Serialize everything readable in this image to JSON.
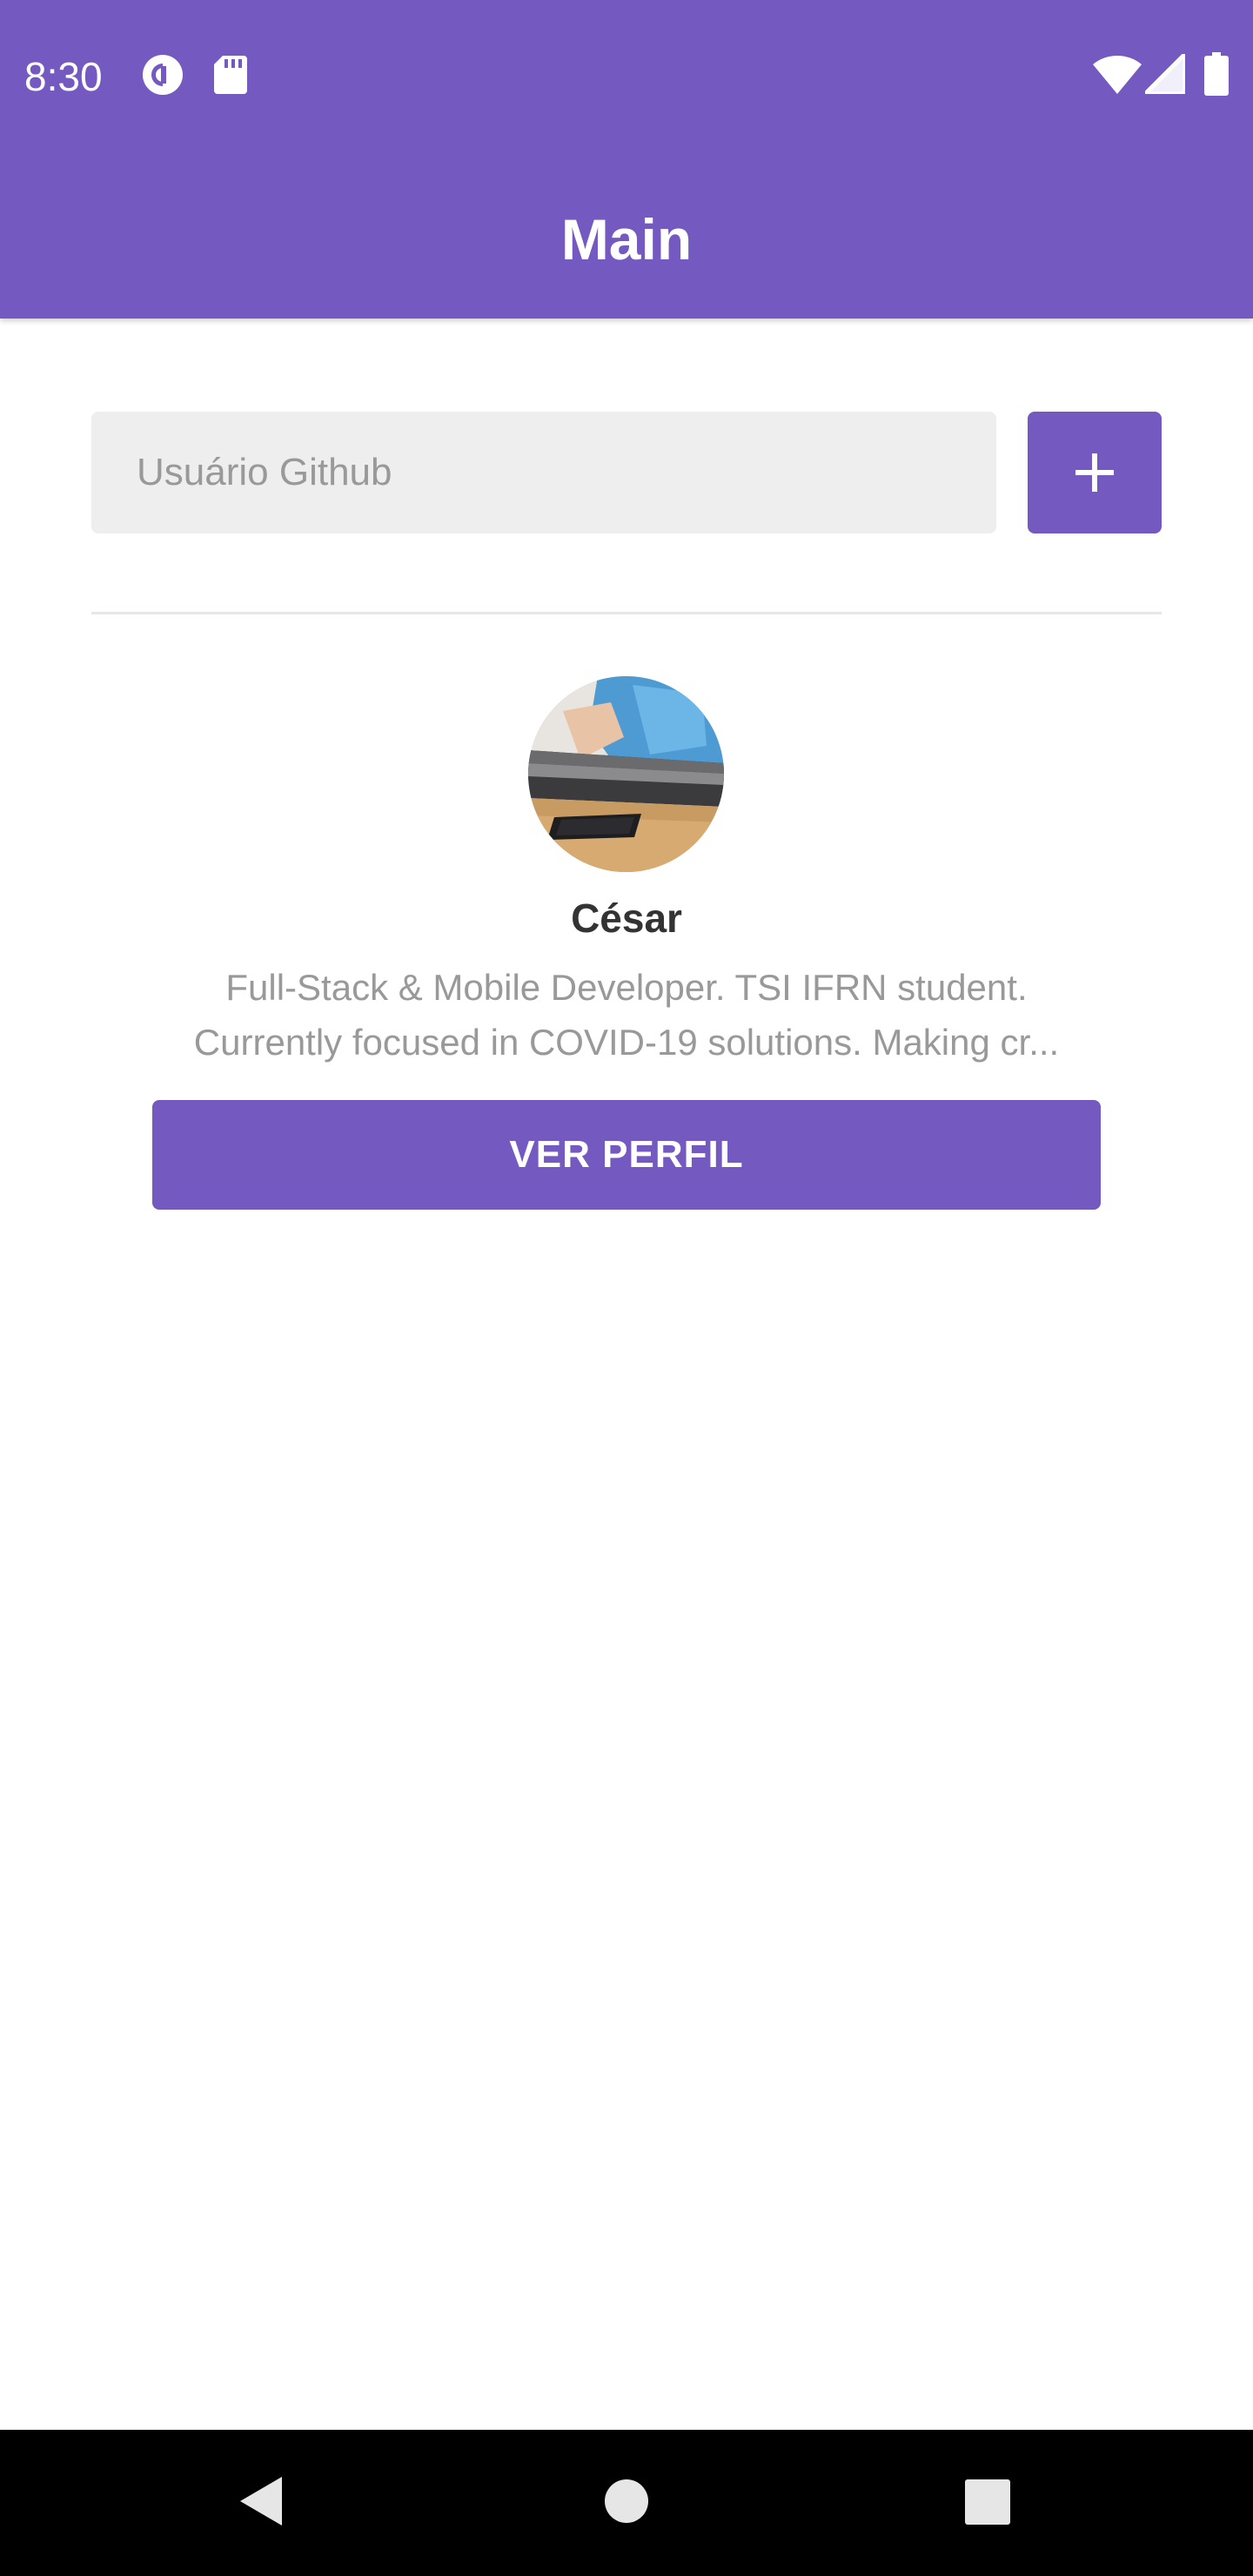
{
  "status_bar": {
    "time": "8:30",
    "icons": [
      "pocket-casts-icon",
      "sd-card-icon",
      "wifi-icon",
      "cell-signal-icon",
      "battery-icon"
    ]
  },
  "app_bar": {
    "title": "Main",
    "background_color": "#7459c1"
  },
  "search": {
    "placeholder": "Usuário Github",
    "value": "",
    "add_button_icon": "plus-icon"
  },
  "user_list": [
    {
      "avatar_icon": "avatar-image",
      "name": "César",
      "bio_line_1": "Full-Stack & Mobile Developer. TSI IFRN student.",
      "bio_line_2": "Currently focused in COVID-19 solutions. Making cr...",
      "button_label": "VER PERFIL"
    }
  ],
  "nav_bar": {
    "icons": [
      "back-icon",
      "home-icon",
      "recents-icon"
    ]
  },
  "colors": {
    "accent": "#7459c1",
    "input_background": "#eeeeee",
    "name_text": "#333333",
    "bio_text": "#999999"
  }
}
